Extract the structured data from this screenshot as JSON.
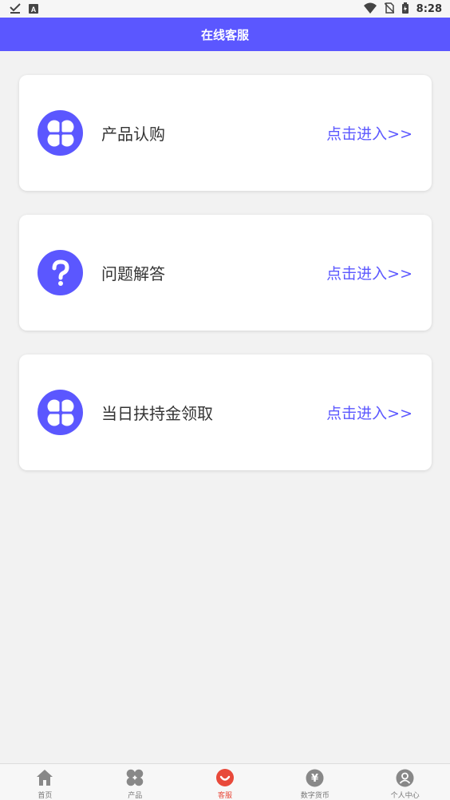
{
  "status_bar": {
    "time": "8:28",
    "left_icons": [
      "download-done-icon",
      "app-a-icon"
    ],
    "right_icons": [
      "wifi-icon",
      "no-sim-icon",
      "battery-icon"
    ]
  },
  "header": {
    "title": "在线客服"
  },
  "cards": [
    {
      "label": "产品认购",
      "link": "点击进入>>",
      "icon": "clover-icon"
    },
    {
      "label": "问题解答",
      "link": "点击进入>>",
      "icon": "question-icon"
    },
    {
      "label": "当日扶持金领取",
      "link": "点击进入>>",
      "icon": "clover-icon"
    }
  ],
  "bottom_nav": {
    "items": [
      {
        "label": "首页",
        "icon": "home-icon",
        "active": false
      },
      {
        "label": "产品",
        "icon": "clover-icon",
        "active": false
      },
      {
        "label": "客服",
        "icon": "customer-service-icon",
        "active": true
      },
      {
        "label": "数字货币",
        "icon": "yen-coin-icon",
        "active": false
      },
      {
        "label": "个人中心",
        "icon": "user-icon",
        "active": false
      }
    ]
  },
  "colors": {
    "accent": "#5b57ff",
    "active_nav": "#e8493a",
    "background": "#f2f2f2"
  }
}
